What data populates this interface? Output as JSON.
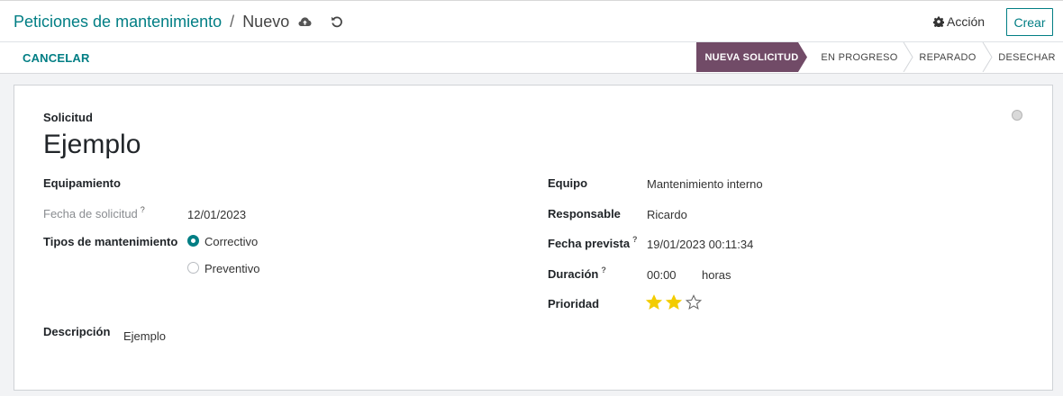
{
  "breadcrumb": {
    "parent": "Peticiones de mantenimiento",
    "separator": "/",
    "current": "Nuevo"
  },
  "toolbar": {
    "save_icon": "cloud-upload-icon",
    "discard_icon": "undo-icon",
    "action_label": "Acción",
    "action_icon": "gear-icon",
    "create_label": "Crear"
  },
  "statusbar": {
    "cancel_label": "CANCELAR",
    "stages": [
      {
        "label": "NUEVA SOLICITUD",
        "active": true
      },
      {
        "label": "EN PROGRESO",
        "active": false
      },
      {
        "label": "REPARADO",
        "active": false
      },
      {
        "label": "DESECHAR",
        "active": false
      }
    ],
    "active_color": "#714b67"
  },
  "form": {
    "request_label": "Solicitud",
    "request_title": "Ejemplo",
    "left": {
      "equipment_label": "Equipamiento",
      "request_date_label": "Fecha de solicitud",
      "request_date_help": "?",
      "request_date_value": "12/01/2023",
      "maintenance_type_label": "Tipos de mantenimiento",
      "maintenance_types": [
        {
          "label": "Correctivo",
          "selected": true
        },
        {
          "label": "Preventivo",
          "selected": false
        }
      ],
      "description_label": "Descripción",
      "description_value": "Ejemplo"
    },
    "right": {
      "team_label": "Equipo",
      "team_value": "Mantenimiento interno",
      "responsible_label": "Responsable",
      "responsible_value": "Ricardo",
      "scheduled_label": "Fecha prevista",
      "scheduled_help": "?",
      "scheduled_value": "19/01/2023 00:11:34",
      "duration_label": "Duración",
      "duration_help": "?",
      "duration_value": "00:00",
      "duration_unit": "horas",
      "priority_label": "Prioridad",
      "priority_value": 2,
      "priority_max": 3
    }
  },
  "colors": {
    "accent": "#017e84",
    "star_on": "#f3cc00"
  }
}
